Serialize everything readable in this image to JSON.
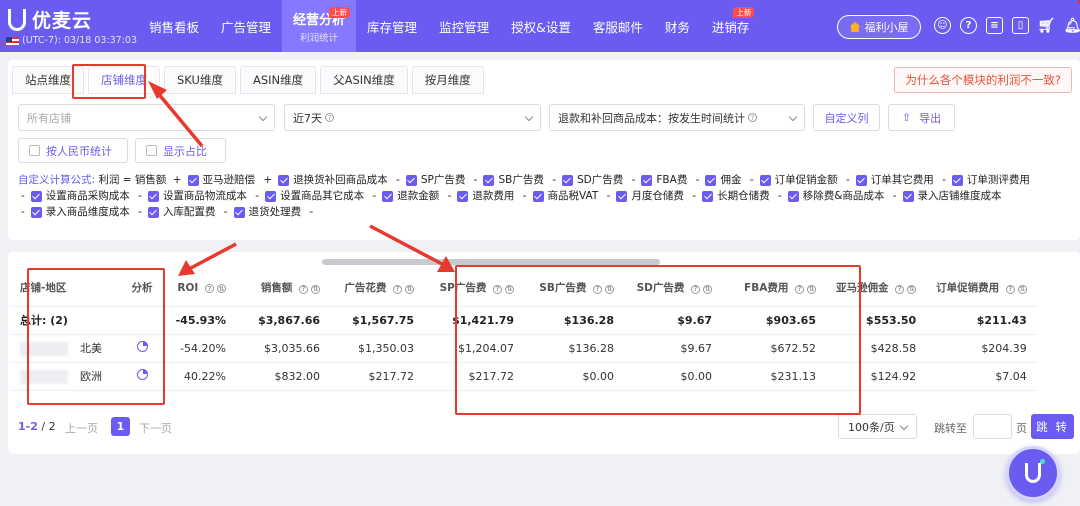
{
  "app": {
    "name": "优麦云",
    "timezone": "(UTC-7): 03/18 03:37:03"
  },
  "nav": [
    {
      "label": "销售看板"
    },
    {
      "label": "广告管理"
    },
    {
      "label": "经营分析",
      "sub": "利润统计",
      "badge": "上新",
      "active": true
    },
    {
      "label": "库存管理"
    },
    {
      "label": "监控管理"
    },
    {
      "label": "授权&设置"
    },
    {
      "label": "客服邮件"
    },
    {
      "label": "财务"
    },
    {
      "label": "进销存",
      "badge": "上新"
    }
  ],
  "header": {
    "welfare": "福利小屋",
    "icons": [
      "support-icon",
      "help-icon",
      "message-icon",
      "tablet-icon",
      "cart-icon",
      "bell-icon",
      "menu-icon"
    ]
  },
  "tabs": [
    "站点维度",
    "店铺维度",
    "SKU维度",
    "ASIN维度",
    "父ASIN维度",
    "按月维度"
  ],
  "why_button": "为什么各个模块的利润不一致?",
  "filters": {
    "store_placeholder": "所有店铺",
    "date_range": "近7天",
    "refund_cost": "退款和补回商品成本：按发生时间统计",
    "custom_columns": "自定义列",
    "export": "导出",
    "rmb_stat": "按人民币统计",
    "show_ratio": "显示占比"
  },
  "formula": {
    "lead": "自定义计算公式:",
    "start": "利润",
    "eq": "= 销售额",
    "items": [
      {
        "op": "+",
        "label": "亚马逊赔偿"
      },
      {
        "op": "+",
        "label": "退换货补回商品成本"
      },
      {
        "op": "-",
        "label": "SP广告费"
      },
      {
        "op": "-",
        "label": "SB广告费"
      },
      {
        "op": "-",
        "label": "SD广告费"
      },
      {
        "op": "-",
        "label": "FBA费"
      },
      {
        "op": "-",
        "label": "佣金"
      },
      {
        "op": "-",
        "label": "订单促销金额"
      },
      {
        "op": "-",
        "label": "订单其它费用"
      },
      {
        "op": "-",
        "label": "订单测评费用"
      },
      {
        "op": "-",
        "label": "设置商品采购成本"
      },
      {
        "op": "-",
        "label": "设置商品物流成本"
      },
      {
        "op": "-",
        "label": "设置商品其它成本"
      },
      {
        "op": "-",
        "label": "退款金额"
      },
      {
        "op": "-",
        "label": "退款费用"
      },
      {
        "op": "-",
        "label": "商品税VAT"
      },
      {
        "op": "-",
        "label": "月度仓储费"
      },
      {
        "op": "-",
        "label": "长期仓储费"
      },
      {
        "op": "-",
        "label": "移除费&商品成本"
      },
      {
        "op": "-",
        "label": "录入店铺维度成本"
      },
      {
        "op": "-",
        "label": "录入商品维度成本"
      },
      {
        "op": "-",
        "label": "入库配置费"
      },
      {
        "op": "-",
        "label": "退货处理费"
      }
    ],
    "trailing_op": "-"
  },
  "table": {
    "columns": [
      "店铺-地区",
      "分析",
      "ROI",
      "销售额",
      "广告花费",
      "SP广告费",
      "SB广告费",
      "SD广告费",
      "FBA费用",
      "亚马逊佣金",
      "订单促销费用"
    ],
    "total": {
      "label": "总计: (2)",
      "roi": "-45.93%",
      "sales": "$3,867.66",
      "ad_spend": "$1,567.75",
      "sp": "$1,421.79",
      "sb": "$136.28",
      "sd": "$9.67",
      "fba": "$903.65",
      "commission": "$553.50",
      "promo": "$211.43"
    },
    "rows": [
      {
        "region": "北美",
        "roi": "-54.20%",
        "sales": "$3,035.66",
        "ad_spend": "$1,350.03",
        "sp": "$1,204.07",
        "sb": "$136.28",
        "sd": "$9.67",
        "fba": "$672.52",
        "commission": "$428.58",
        "promo": "$204.39"
      },
      {
        "region": "欧洲",
        "roi": "40.22%",
        "sales": "$832.00",
        "ad_spend": "$217.72",
        "sp": "$217.72",
        "sb": "$0.00",
        "sd": "$0.00",
        "fba": "$231.13",
        "commission": "$124.92",
        "promo": "$7.04"
      }
    ]
  },
  "pager": {
    "range": "1-2",
    "total": "2",
    "prev": "上一页",
    "page": "1",
    "next": "下一页",
    "size": "100条/页",
    "goto": "跳转至",
    "page_unit": "页",
    "jump": "跳 转"
  },
  "colors": {
    "brand": "#6a5cf0",
    "annotation": "#e8392e"
  }
}
